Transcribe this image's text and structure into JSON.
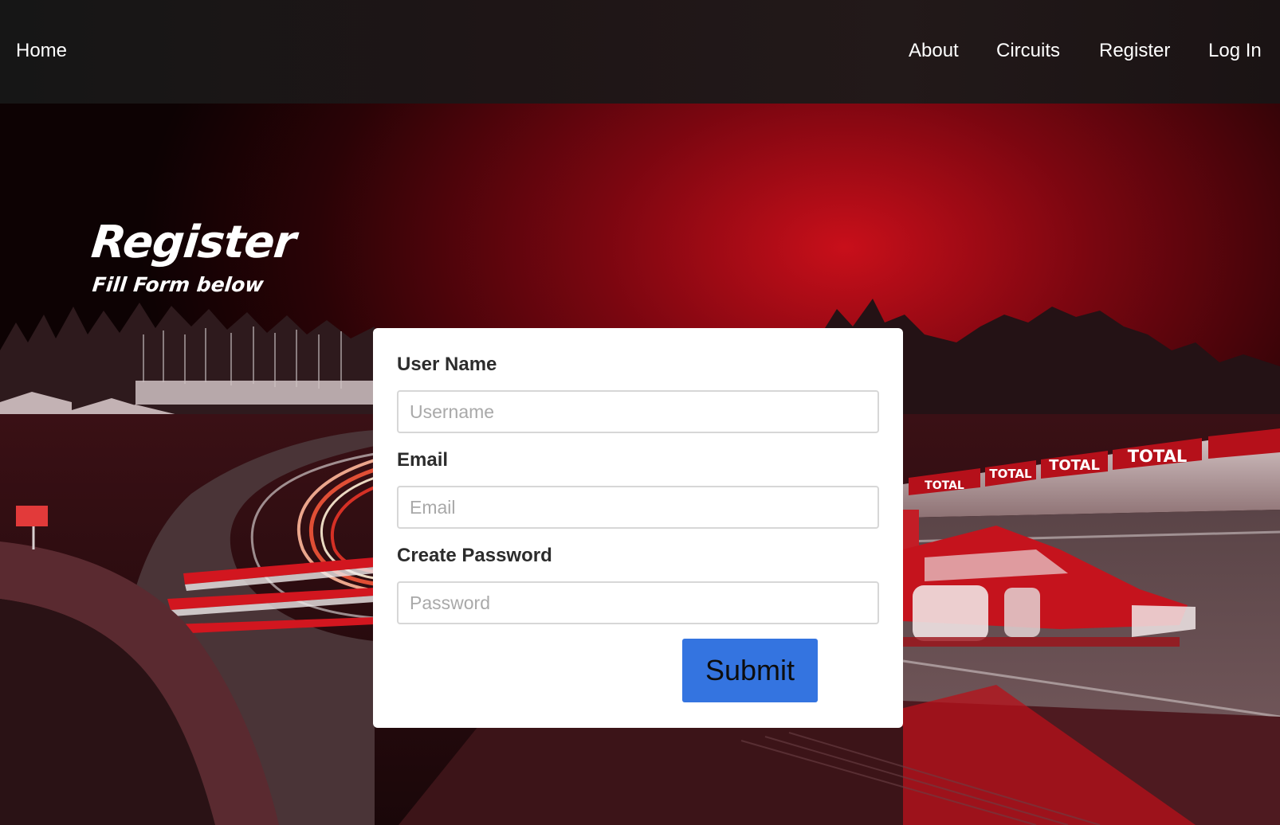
{
  "nav": {
    "home": "Home",
    "about": "About",
    "circuits": "Circuits",
    "register": "Register",
    "login": "Log In"
  },
  "hero": {
    "title": "Register",
    "subtitle": "Fill Form below"
  },
  "form": {
    "username_label": "User Name",
    "username_placeholder": "Username",
    "email_label": "Email",
    "email_placeholder": "Email",
    "password_label": "Create Password",
    "password_placeholder": "Password",
    "submit_label": "Submit"
  },
  "banner_text": "TOTAL",
  "colors": {
    "accent": "#3474e0",
    "sky_glow": "#c4101a",
    "navbar": "#1c1516"
  }
}
